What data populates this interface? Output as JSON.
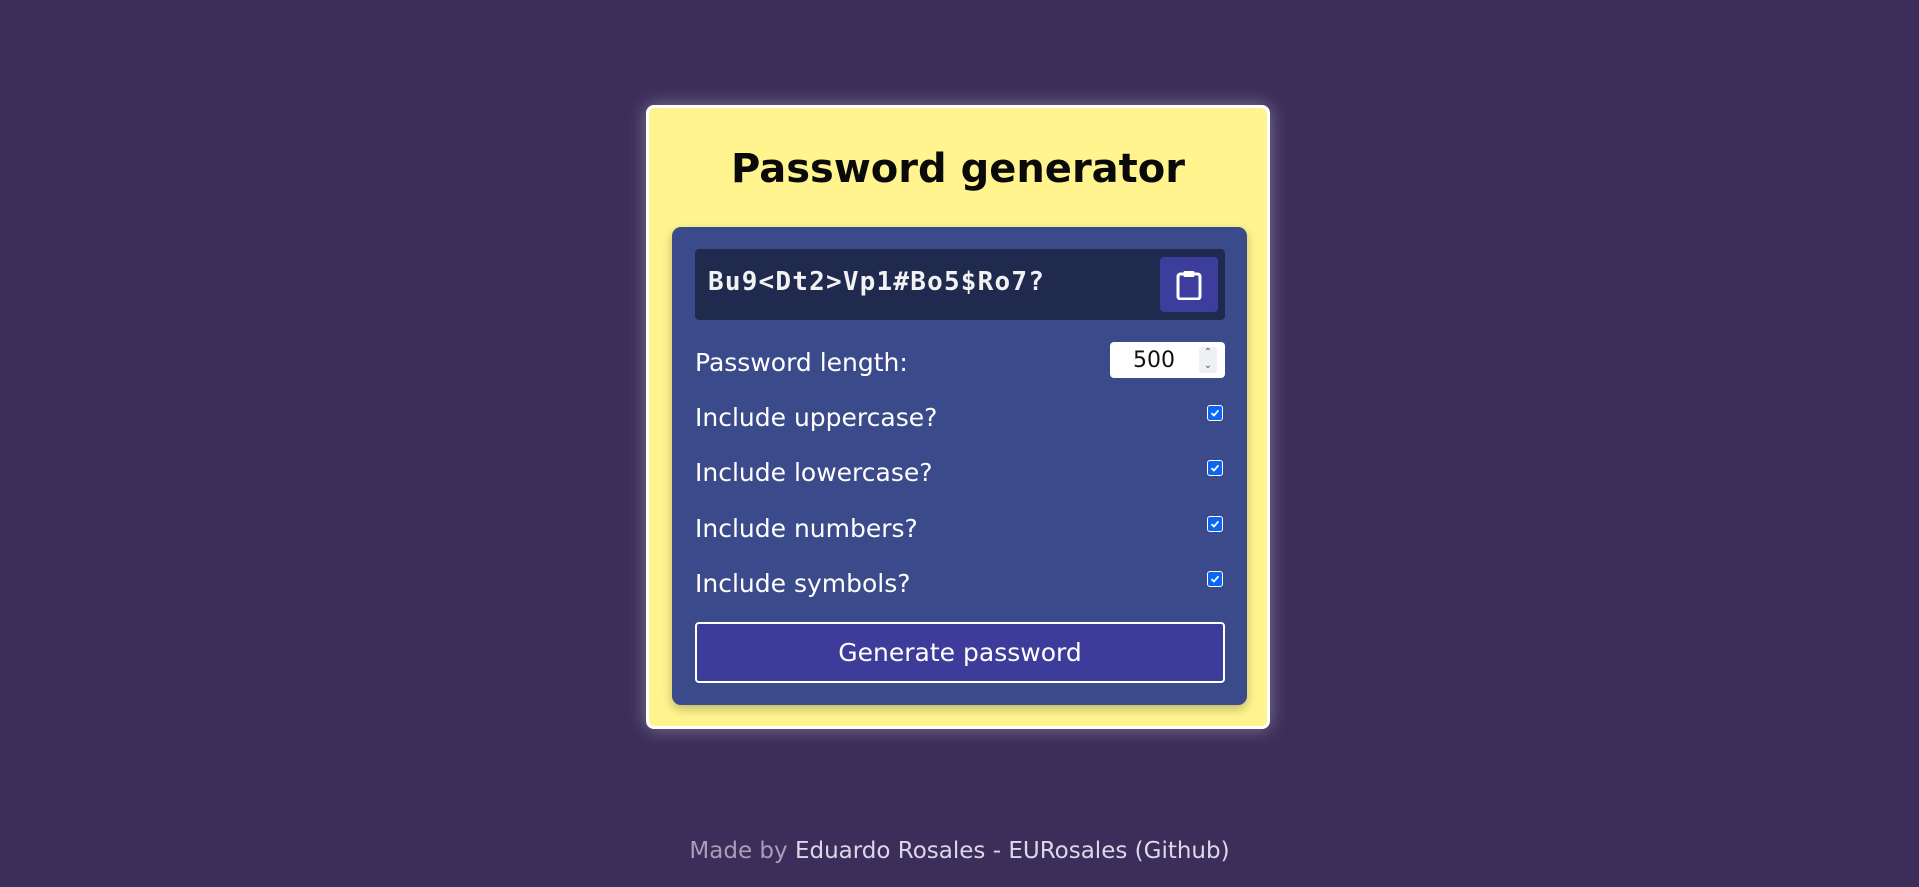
{
  "app": {
    "title": "Password generator"
  },
  "result": {
    "password": "Bu9<Dt2>Vp1#Bo5$Ro7?"
  },
  "copy_button": {
    "icon": "clipboard-icon"
  },
  "settings": {
    "length": {
      "label": "Password length:",
      "value": "500"
    },
    "options": [
      {
        "label": "Include uppercase?",
        "checked": true
      },
      {
        "label": "Include lowercase?",
        "checked": true
      },
      {
        "label": "Include numbers?",
        "checked": true
      },
      {
        "label": "Include symbols?",
        "checked": true
      }
    ]
  },
  "generate_button": {
    "label": "Generate password"
  },
  "footer": {
    "prefix": "Made by",
    "author": "Eduardo Rosales",
    "separator": "-",
    "github": "EURosales (Github)"
  },
  "colors": {
    "background": "#3b2e5a",
    "card": "#fff48e",
    "panel": "#3b4a8a",
    "result_bg": "#202a4f",
    "button": "#3d3c9a",
    "checkbox": "#0b66f0"
  }
}
